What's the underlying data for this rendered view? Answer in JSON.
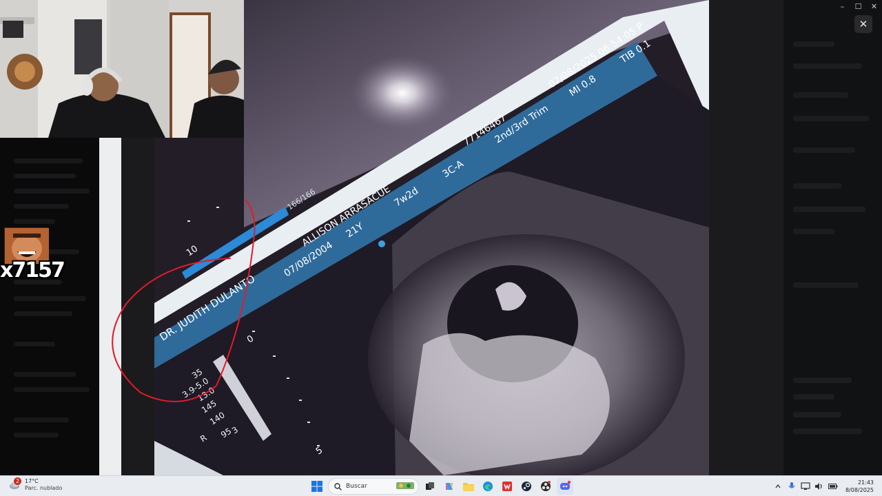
{
  "ultrasound": {
    "doctor": "DR. JUDITH DULANTO",
    "patient": "ALLISON ARRASACUE",
    "dob": "07/08/2004",
    "age": "21Y",
    "ga": "7w2d",
    "patient_id": "77146467",
    "probe": "3C-A",
    "exam": "2nd/3rd Trim",
    "datetime": "07/08/2025 06:54:05 P",
    "mi": "MI 0.8",
    "tib": "TIB 0.1",
    "frame": "166/166",
    "depth_10": "10",
    "depth_0": "0",
    "depth_5": "5",
    "params": [
      "35",
      "3.9-5.0",
      "13.0",
      "145",
      "140",
      "95",
      "3"
    ],
    "param_prefixes": [
      "",
      "",
      "",
      "",
      "",
      "R",
      ""
    ]
  },
  "overlay": {
    "emote_count": "x7157"
  },
  "viewer": {
    "close_symbol": "✕"
  },
  "window_controls": [
    "–",
    "☐",
    "✕"
  ],
  "taskbar": {
    "weather_badge": "2",
    "weather_temp": "17°C",
    "weather_desc": "Parc. nublado",
    "search_placeholder": "Buscar",
    "time": "21:43",
    "date": "8/08/2025",
    "pinned_apps": [
      "windows-start",
      "search",
      "task-view",
      "copilot",
      "file-explorer",
      "edge",
      "office",
      "steam",
      "obs",
      "discord"
    ]
  }
}
